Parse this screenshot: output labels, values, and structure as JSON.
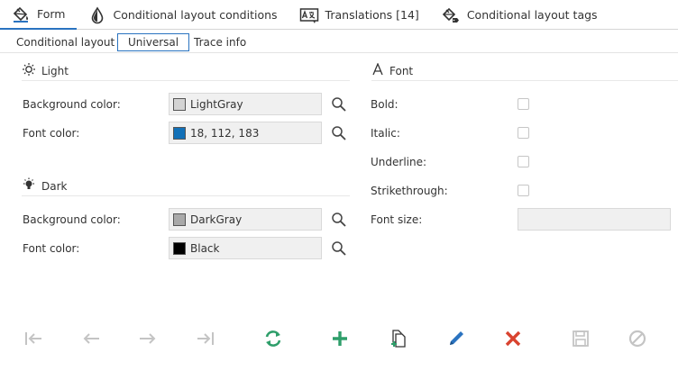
{
  "top_tabs": [
    {
      "label": "Form",
      "icon": "paint-bucket-icon",
      "active": true
    },
    {
      "label": "Conditional layout conditions",
      "icon": "drop-icon"
    },
    {
      "label": "Translations [14]",
      "icon": "translate-icon"
    },
    {
      "label": "Conditional layout tags",
      "icon": "tag-bucket-icon"
    }
  ],
  "sub_tabs": [
    {
      "label": "Conditional layout"
    },
    {
      "label": "Universal",
      "active": true
    },
    {
      "label": "Trace info"
    }
  ],
  "light": {
    "title": "Light",
    "background_label": "Background color:",
    "background_value": "LightGray",
    "background_swatch": "#d3d3d3",
    "font_label": "Font color:",
    "font_value": "18, 112, 183",
    "font_swatch": "#1270b7"
  },
  "dark": {
    "title": "Dark",
    "background_label": "Background color:",
    "background_value": "DarkGray",
    "background_swatch": "#a9a9a9",
    "font_label": "Font color:",
    "font_value": "Black",
    "font_swatch": "#000000"
  },
  "font": {
    "title": "Font",
    "bold_label": "Bold:",
    "italic_label": "Italic:",
    "underline_label": "Underline:",
    "strikethrough_label": "Strikethrough:",
    "size_label": "Font size:",
    "size_value": ""
  },
  "toolbar": [
    {
      "name": "first-record-icon",
      "enabled": false
    },
    {
      "name": "previous-record-icon",
      "enabled": false
    },
    {
      "name": "next-record-icon",
      "enabled": false
    },
    {
      "name": "last-record-icon",
      "enabled": false
    },
    {
      "name": "refresh-icon",
      "enabled": true
    },
    {
      "name": "add-icon",
      "enabled": true
    },
    {
      "name": "copy-icon",
      "enabled": true
    },
    {
      "name": "edit-icon",
      "enabled": true
    },
    {
      "name": "delete-icon",
      "enabled": true
    },
    {
      "name": "save-icon",
      "enabled": false
    },
    {
      "name": "cancel-icon",
      "enabled": false
    }
  ],
  "colors": {
    "accent": "#2a73c0",
    "green": "#2e9e6a",
    "red": "#d9432f",
    "disabled": "#c4c4c4"
  }
}
